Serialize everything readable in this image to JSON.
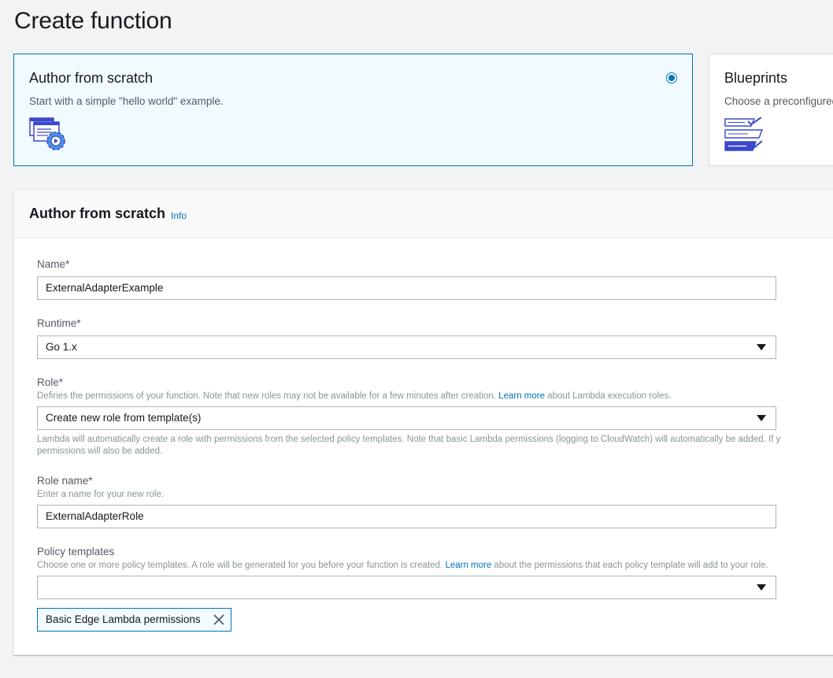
{
  "page": {
    "title": "Create function"
  },
  "cards": {
    "author": {
      "title": "Author from scratch",
      "description": "Start with a simple \"hello world\" example.",
      "selected": true
    },
    "blueprints": {
      "title": "Blueprints",
      "description": "Choose a preconfigured"
    }
  },
  "form": {
    "title": "Author from scratch",
    "info_link": "Info",
    "name": {
      "label": "Name*",
      "value": "ExternalAdapterExample"
    },
    "runtime": {
      "label": "Runtime*",
      "value": "Go 1.x"
    },
    "role": {
      "label": "Role*",
      "desc_before": "Defines the permissions of your function. Note that new roles may not be available for a few minutes after creation. ",
      "desc_link": "Learn more",
      "desc_after": " about Lambda execution roles.",
      "value": "Create new role from template(s)",
      "note_line1": "Lambda will automatically create a role with permissions from the selected policy templates. Note that basic Lambda permissions (logging to CloudWatch) will automatically be added. If y",
      "note_line2": "permissions will also be added."
    },
    "role_name": {
      "label": "Role name*",
      "description": "Enter a name for your new role.",
      "value": "ExternalAdapterRole"
    },
    "policy_templates": {
      "label": "Policy templates",
      "desc_before": "Choose one or more policy templates. A role will be generated for you before your function is created. ",
      "desc_link": "Learn more",
      "desc_after": " about the permissions that each policy template will add to your role.",
      "value": "",
      "selected_tokens": [
        "Basic Edge Lambda permissions"
      ]
    }
  },
  "colors": {
    "accent": "#0073bb",
    "selected_bg": "#f1faff",
    "page_bg": "#f2f3f3"
  },
  "icons": [
    "radio-selected-icon",
    "author-gear-icon",
    "blueprints-checklist-icon",
    "dropdown-arrow-icon",
    "close-icon"
  ]
}
